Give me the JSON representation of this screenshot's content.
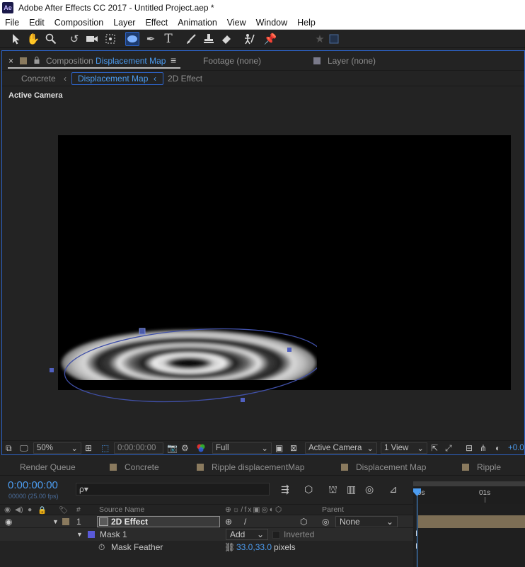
{
  "window": {
    "app_icon": "Ae",
    "title": "Adobe After Effects CC 2017 - Untitled Project.aep *"
  },
  "menu": [
    "File",
    "Edit",
    "Composition",
    "Layer",
    "Effect",
    "Animation",
    "View",
    "Window",
    "Help"
  ],
  "tools": [
    "selection-tool-icon",
    "hand-tool-icon",
    "zoom-tool-icon",
    "rotate-tool-icon",
    "camera-tool-icon",
    "pan-behind-tool-icon",
    "ellipse-tool-icon",
    "pen-tool-icon",
    "type-tool-icon",
    "brush-tool-icon",
    "clone-stamp-icon",
    "eraser-icon",
    "roto-brush-icon",
    "puppet-pin-icon"
  ],
  "comp_panel": {
    "close": "×",
    "comp_prefix": "Composition",
    "comp_name": "Displacement Map",
    "menu_glyph": "≡",
    "footage_tab": "Footage (none)",
    "layer_tab": "Layer (none)",
    "breadcrumbs": [
      "Concrete",
      "Displacement Map",
      "2D Effect"
    ],
    "active_camera_label": "Active Camera"
  },
  "viewer_bar": {
    "zoom": "50%",
    "timecode": "0:00:00:00",
    "resolution": "Full",
    "camera": "Active Camera",
    "views": "1 View",
    "exposure": "+0.0"
  },
  "project_tabs": [
    "Render Queue",
    "Concrete",
    "Ripple displacementMap",
    "Displacement Map",
    "Ripple"
  ],
  "tab_colors": {
    "concrete": "#8a7a5e",
    "ripple_displacement": "#8a7a5e",
    "displacement_map": "#8a7a5e",
    "ripple": "#8a7a5e",
    "mask": "#5a5ad8",
    "layer_label": "#8a7a5e",
    "accent": "#4c9cf0"
  },
  "timeline": {
    "timecode": "0:00:00:00",
    "fps": "00000 (25.00 fps)",
    "search_placeholder": "ρ▾",
    "columns": {
      "hash": "#",
      "source_name": "Source Name",
      "parent": "Parent"
    },
    "ruler": [
      "0s",
      "01s"
    ],
    "layer": {
      "index": "1",
      "name": "2D Effect",
      "parent": "None"
    },
    "mask": {
      "name": "Mask 1",
      "mode": "Add",
      "inverted": "Inverted"
    },
    "feather": {
      "label": "Mask Feather",
      "value": "33.0,33.0",
      "unit": "pixels"
    }
  }
}
